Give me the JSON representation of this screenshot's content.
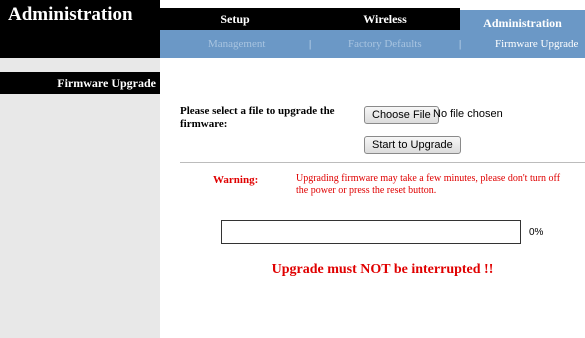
{
  "header": {
    "title": "Administration",
    "tabs": [
      {
        "label": "Setup"
      },
      {
        "label": "Wireless"
      },
      {
        "label": "Administration"
      }
    ],
    "subnav": [
      {
        "label": "Management"
      },
      {
        "label": "Factory Defaults"
      },
      {
        "label": "Firmware Upgrade"
      }
    ],
    "separator": "|"
  },
  "sidebar": {
    "section_title": "Firmware Upgrade"
  },
  "form": {
    "select_label": "Please select a file to upgrade the firmware:",
    "choose_button": "Choose File",
    "file_status": "No file chosen",
    "start_button": "Start to Upgrade"
  },
  "warning": {
    "label": "Warning:",
    "text": "Upgrading firmware may take a few minutes, please don't turn off the power or press the reset button."
  },
  "progress": {
    "value_percent": 0,
    "label": "0%"
  },
  "notice": "Upgrade must NOT be interrupted !!",
  "colors": {
    "accent": "#6b98c6",
    "warning": "#e00000",
    "header": "#000000"
  }
}
